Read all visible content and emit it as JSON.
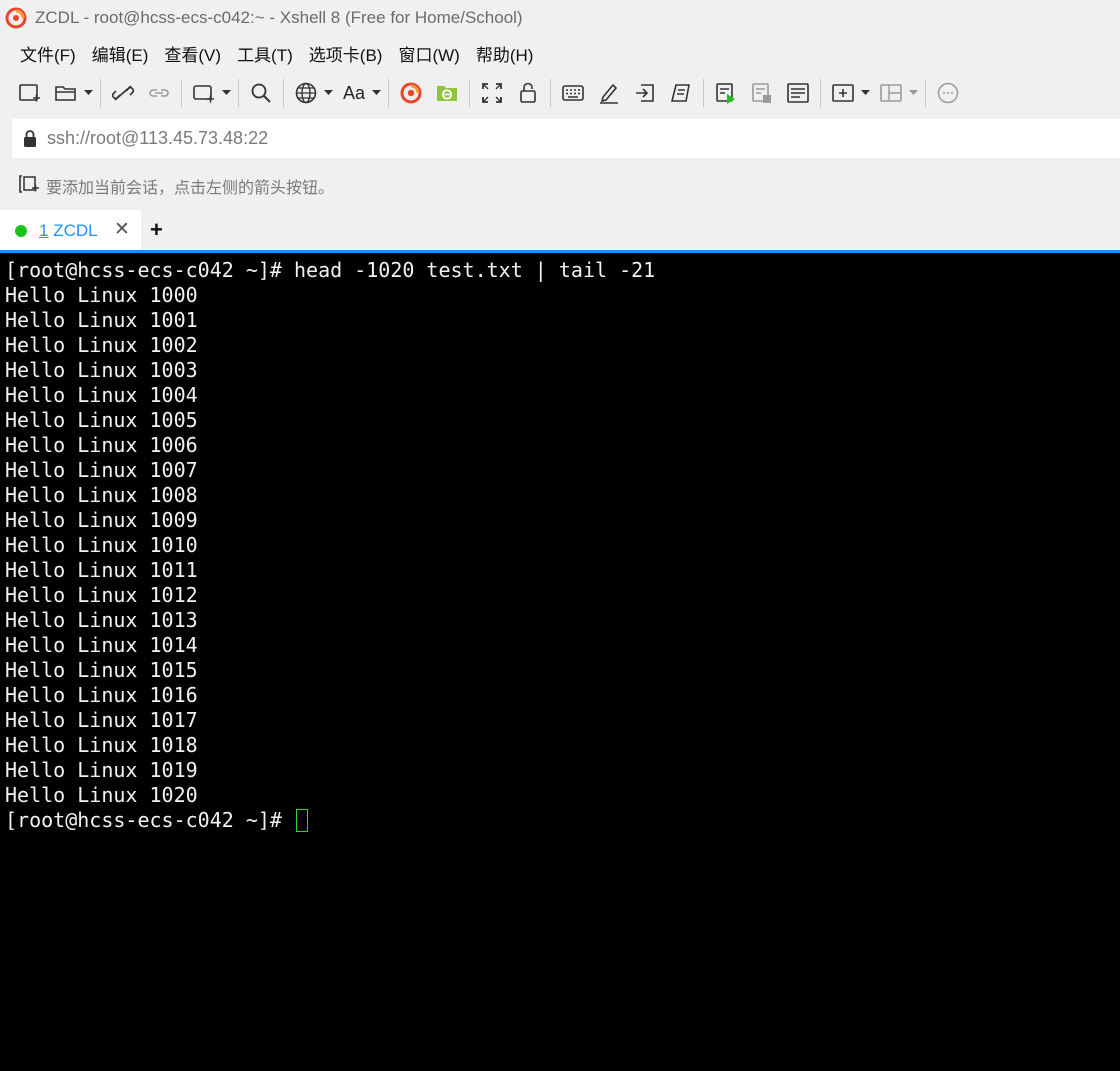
{
  "window": {
    "title": "ZCDL - root@hcss-ecs-c042:~ - Xshell 8 (Free for Home/School)"
  },
  "menu": {
    "items": [
      {
        "label": "文件(F)"
      },
      {
        "label": "编辑(E)"
      },
      {
        "label": "查看(V)"
      },
      {
        "label": "工具(T)"
      },
      {
        "label": "选项卡(B)"
      },
      {
        "label": "窗口(W)"
      },
      {
        "label": "帮助(H)"
      }
    ]
  },
  "toolbar": {
    "font_label": "Aa",
    "icons": [
      "new-session-icon",
      "open-folder-icon",
      "disconnect-icon",
      "reconnect-icon",
      "new-window-icon",
      "find-icon",
      "globe-icon",
      "font-icon",
      "xshell-icon",
      "xftp-icon",
      "fullscreen-icon",
      "lock-icon",
      "keyboard-icon",
      "highlight-icon",
      "send-icon",
      "script-icon",
      "run-script-icon",
      "log-icon",
      "notes-icon",
      "new-tab-icon",
      "layout-icon",
      "chat-icon"
    ]
  },
  "address": {
    "value": "ssh://root@113.45.73.48:22"
  },
  "hint": {
    "text": "要添加当前会话，点击左侧的箭头按钮。"
  },
  "tabs": [
    {
      "number": "1",
      "name": "ZCDL",
      "status_color": "#1ec21e"
    }
  ],
  "tab_add_label": "+",
  "terminal": {
    "lines": [
      "[root@hcss-ecs-c042 ~]# head -1020 test.txt | tail -21",
      "Hello Linux 1000",
      "Hello Linux 1001",
      "Hello Linux 1002",
      "Hello Linux 1003",
      "Hello Linux 1004",
      "Hello Linux 1005",
      "Hello Linux 1006",
      "Hello Linux 1007",
      "Hello Linux 1008",
      "Hello Linux 1009",
      "Hello Linux 1010",
      "Hello Linux 1011",
      "Hello Linux 1012",
      "Hello Linux 1013",
      "Hello Linux 1014",
      "Hello Linux 1015",
      "Hello Linux 1016",
      "Hello Linux 1017",
      "Hello Linux 1018",
      "Hello Linux 1019",
      "Hello Linux 1020"
    ],
    "prompt": "[root@hcss-ecs-c042 ~]# ",
    "cursor_color": "#2fd62f"
  }
}
